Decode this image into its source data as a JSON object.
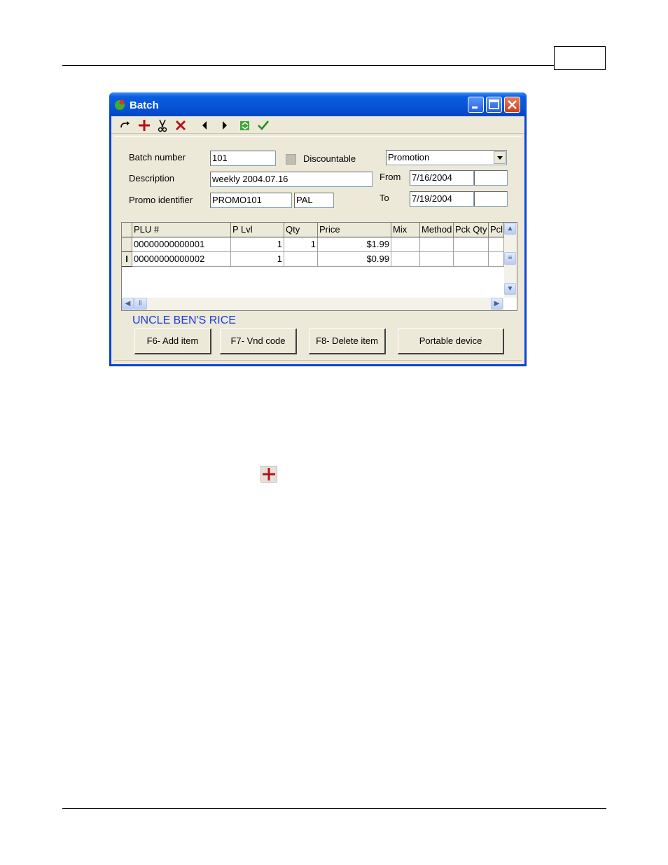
{
  "window": {
    "title": "Batch",
    "toolbar_icons": [
      "redo-icon",
      "add-icon",
      "cut-icon",
      "delete-icon",
      "prev-icon",
      "next-icon",
      "refresh-icon",
      "confirm-icon"
    ]
  },
  "form": {
    "batch_number_label": "Batch number",
    "batch_number_value": "101",
    "discountable_label": "Discountable",
    "type_value": "Promotion",
    "description_label": "Description",
    "description_value": "weekly 2004.07.16",
    "from_label": "From",
    "from_value": "7/16/2004",
    "promo_identifier_label": "Promo identifier",
    "promo_identifier_value": "PROMO101",
    "promo_code_value": "PAL",
    "to_label": "To",
    "to_value": "7/19/2004"
  },
  "grid": {
    "columns": [
      "PLU #",
      "P Lvl",
      "Qty",
      "Price",
      "Mix",
      "Method",
      "Pck Qty",
      "Pcl"
    ],
    "rows": [
      {
        "indicator": "",
        "plu": "00000000000001",
        "plvl": "1",
        "qty": "1",
        "price": "$1.99",
        "mix": "",
        "method": "",
        "pckqty": "",
        "pcl": ""
      },
      {
        "indicator": "I",
        "plu": "00000000000002",
        "plvl": "1",
        "qty": "",
        "price": "$0.99",
        "mix": "",
        "method": "",
        "pckqty": "",
        "pcl": ""
      }
    ]
  },
  "selected_item_name": "UNCLE BEN'S RICE",
  "buttons": {
    "add_item": "F6- Add item",
    "vnd_code": "F7- Vnd code",
    "delete_item": "F8- Delete item",
    "portable_device": "Portable device"
  },
  "colors": {
    "titlebar": "#0554d6",
    "window_bg": "#ece9d8",
    "selected_item_text": "#1a3ce0",
    "add_icon": "#b3121a"
  }
}
